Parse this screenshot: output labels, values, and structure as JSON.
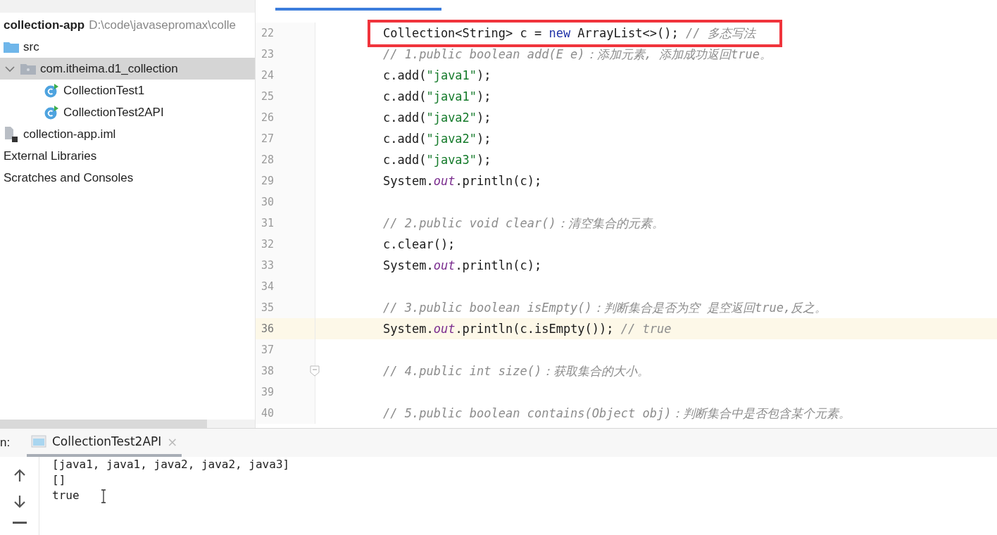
{
  "project_tree": {
    "items": [
      {
        "kind": "module",
        "label": "collection-app",
        "path": "D:\\code\\javasepromax\\colle",
        "selected": false
      },
      {
        "kind": "folder",
        "label": "src",
        "selected": false
      },
      {
        "kind": "package",
        "label": "com.itheima.d1_collection",
        "selected": true,
        "expanded": true,
        "children": [
          {
            "kind": "class",
            "label": "CollectionTest1",
            "selected": false
          },
          {
            "kind": "class",
            "label": "CollectionTest2API",
            "selected": false
          }
        ]
      },
      {
        "kind": "module-file",
        "label": "collection-app.iml",
        "selected": false
      },
      {
        "kind": "plain",
        "label": "External Libraries",
        "selected": false
      },
      {
        "kind": "plain",
        "label": "Scratches and Consoles",
        "selected": false
      }
    ]
  },
  "editor": {
    "lines": [
      {
        "number": "22",
        "boxed": true,
        "segments": [
          {
            "kind": "plain",
            "text": "Collection<String> c = "
          },
          {
            "kind": "keyword",
            "text": "new"
          },
          {
            "kind": "plain",
            "text": " ArrayList<>(); "
          },
          {
            "kind": "comment",
            "text": "// 多态写法"
          }
        ]
      },
      {
        "number": "23",
        "segments": [
          {
            "kind": "comment",
            "text": "// 1.public boolean add(E e)：添加元素, 添加成功返回true。"
          }
        ]
      },
      {
        "number": "24",
        "segments": [
          {
            "kind": "plain",
            "text": "c.add("
          },
          {
            "kind": "string",
            "text": "\"java1\""
          },
          {
            "kind": "plain",
            "text": ");"
          }
        ]
      },
      {
        "number": "25",
        "segments": [
          {
            "kind": "plain",
            "text": "c.add("
          },
          {
            "kind": "string",
            "text": "\"java1\""
          },
          {
            "kind": "plain",
            "text": ");"
          }
        ]
      },
      {
        "number": "26",
        "segments": [
          {
            "kind": "plain",
            "text": "c.add("
          },
          {
            "kind": "string",
            "text": "\"java2\""
          },
          {
            "kind": "plain",
            "text": ");"
          }
        ]
      },
      {
        "number": "27",
        "segments": [
          {
            "kind": "plain",
            "text": "c.add("
          },
          {
            "kind": "string",
            "text": "\"java2\""
          },
          {
            "kind": "plain",
            "text": ");"
          }
        ]
      },
      {
        "number": "28",
        "segments": [
          {
            "kind": "plain",
            "text": "c.add("
          },
          {
            "kind": "string",
            "text": "\"java3\""
          },
          {
            "kind": "plain",
            "text": ");"
          }
        ]
      },
      {
        "number": "29",
        "segments": [
          {
            "kind": "plain",
            "text": "System."
          },
          {
            "kind": "field",
            "text": "out"
          },
          {
            "kind": "plain",
            "text": ".println(c);"
          }
        ]
      },
      {
        "number": "30"
      },
      {
        "number": "31",
        "segments": [
          {
            "kind": "comment",
            "text": "// 2.public void clear()：清空集合的元素。"
          }
        ]
      },
      {
        "number": "32",
        "segments": [
          {
            "kind": "plain",
            "text": "c.clear();"
          }
        ]
      },
      {
        "number": "33",
        "segments": [
          {
            "kind": "plain",
            "text": "System."
          },
          {
            "kind": "field",
            "text": "out"
          },
          {
            "kind": "plain",
            "text": ".println(c);"
          }
        ]
      },
      {
        "number": "34"
      },
      {
        "number": "35",
        "segments": [
          {
            "kind": "comment",
            "text": "// 3.public boolean isEmpty()：判断集合是否为空 是空返回true,反之。"
          }
        ]
      },
      {
        "number": "36",
        "current": true,
        "segments": [
          {
            "kind": "plain",
            "text": "System."
          },
          {
            "kind": "field",
            "text": "out"
          },
          {
            "kind": "plain",
            "text": ".println(c.isEmpty()); "
          },
          {
            "kind": "comment",
            "text": "// true"
          }
        ]
      },
      {
        "number": "37"
      },
      {
        "number": "38",
        "fold": true,
        "segments": [
          {
            "kind": "comment",
            "text": "// 4.public int size()：获取集合的大小。"
          }
        ]
      },
      {
        "number": "39"
      },
      {
        "number": "40",
        "segments": [
          {
            "kind": "comment",
            "text": "// 5.public boolean contains(Object obj)：判断集合中是否包含某个元素。"
          }
        ]
      }
    ]
  },
  "run_panel": {
    "label": "n:",
    "tabs": [
      {
        "label": "CollectionTest2API",
        "close": "×",
        "selected": true
      }
    ],
    "output": [
      "[java1, java1, java2, java2, java3]",
      "[]",
      "true"
    ]
  }
}
